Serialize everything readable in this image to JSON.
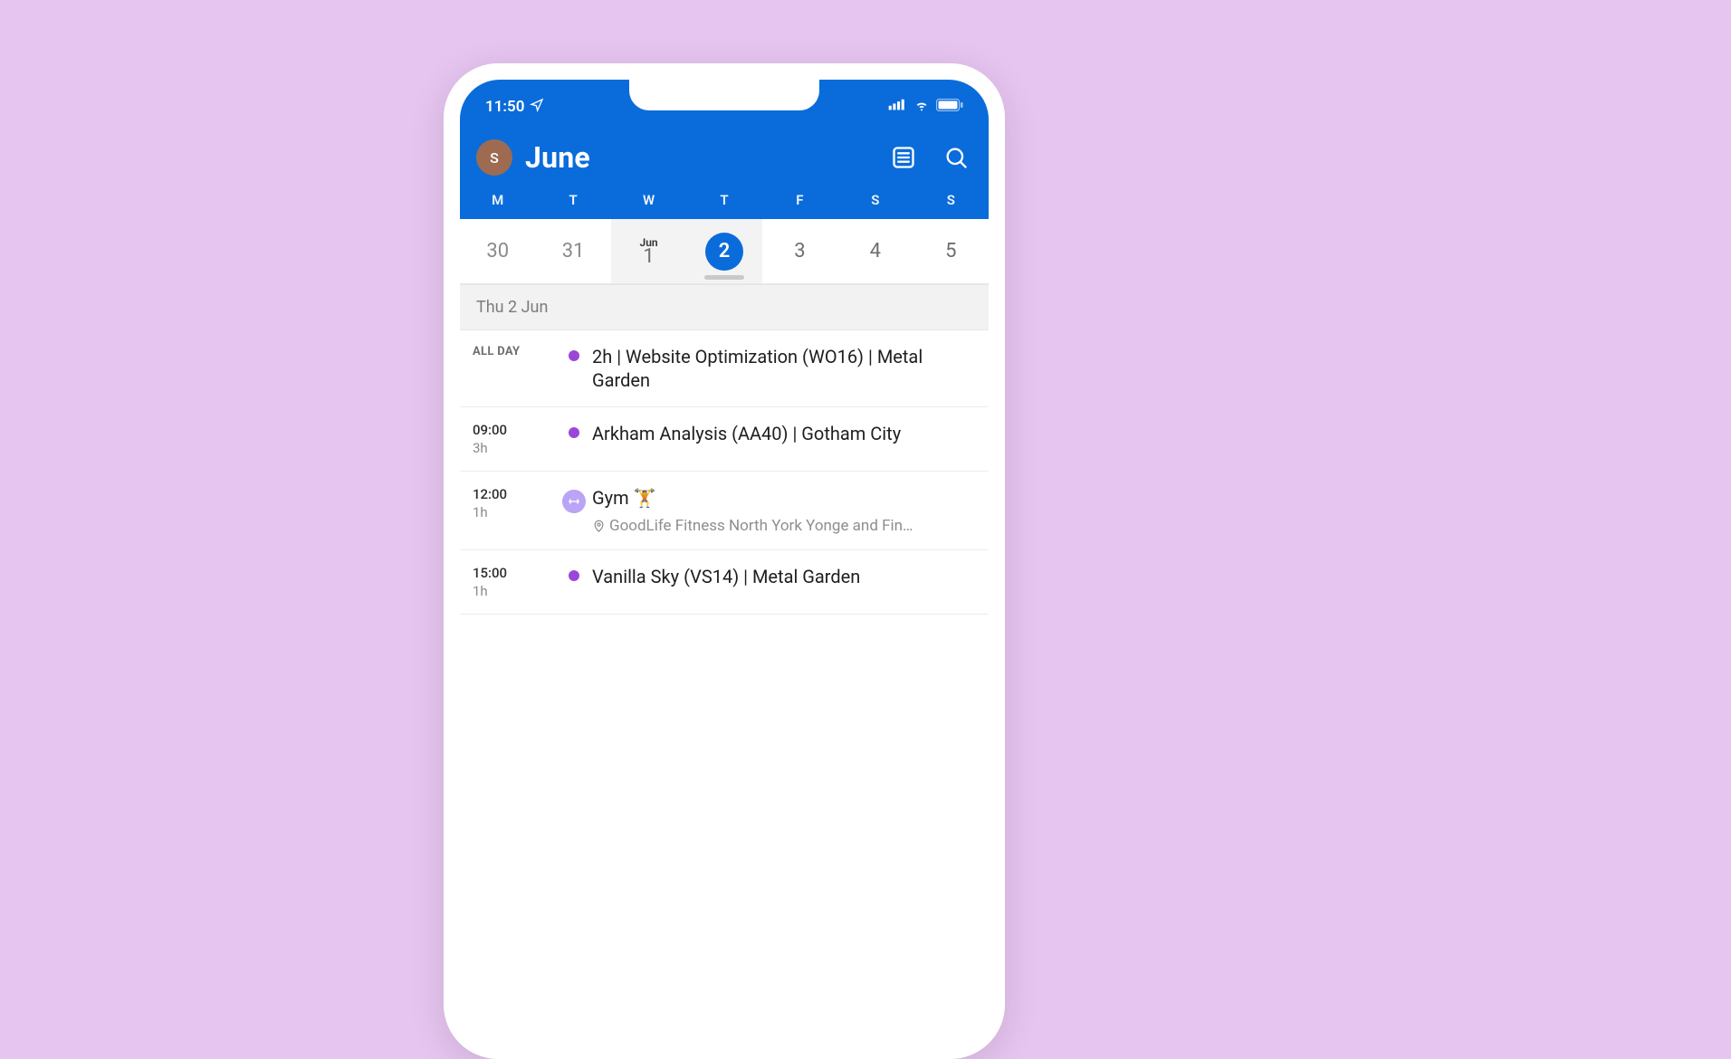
{
  "statusbar": {
    "time": "11:50",
    "location_icon": "location-arrow",
    "signal_icon": "cellular-bars",
    "wifi_icon": "wifi",
    "battery_icon": "battery"
  },
  "header": {
    "avatar_letter": "S",
    "month_title": "June",
    "agenda_icon": "list",
    "search_icon": "search"
  },
  "weekdays": [
    "M",
    "T",
    "W",
    "T",
    "F",
    "S",
    "S"
  ],
  "dates": [
    {
      "label": "30",
      "pre": "",
      "dim": true,
      "selected": false,
      "today_col": false
    },
    {
      "label": "31",
      "pre": "",
      "dim": true,
      "selected": false,
      "today_col": false
    },
    {
      "label": "1",
      "pre": "Jun",
      "dim": false,
      "selected": false,
      "today_col": true
    },
    {
      "label": "2",
      "pre": "",
      "dim": false,
      "selected": true,
      "today_col": true
    },
    {
      "label": "3",
      "pre": "",
      "dim": false,
      "selected": false,
      "today_col": false
    },
    {
      "label": "4",
      "pre": "",
      "dim": false,
      "selected": false,
      "today_col": false
    },
    {
      "label": "5",
      "pre": "",
      "dim": false,
      "selected": false,
      "today_col": false
    }
  ],
  "agenda": {
    "day_label": "Thu 2 Jun",
    "events": [
      {
        "time_primary": "ALL DAY",
        "time_secondary": "",
        "allday": true,
        "marker": "dot",
        "marker_color": "#9B46D8",
        "title": "2h | Website Optimization (WO16) | Metal Garden",
        "location": ""
      },
      {
        "time_primary": "09:00",
        "time_secondary": "3h",
        "allday": false,
        "marker": "dot",
        "marker_color": "#9B46D8",
        "title": "Arkham Analysis (AA40) | Gotham City",
        "location": ""
      },
      {
        "time_primary": "12:00",
        "time_secondary": "1h",
        "allday": false,
        "marker": "badge",
        "marker_color": "#B9A4F5",
        "title": "Gym 🏋️",
        "location": "GoodLife Fitness North York Yonge and Fin…"
      },
      {
        "time_primary": "15:00",
        "time_secondary": "1h",
        "allday": false,
        "marker": "dot",
        "marker_color": "#9B46D8",
        "title": "Vanilla Sky (VS14) | Metal Garden",
        "location": ""
      }
    ]
  }
}
